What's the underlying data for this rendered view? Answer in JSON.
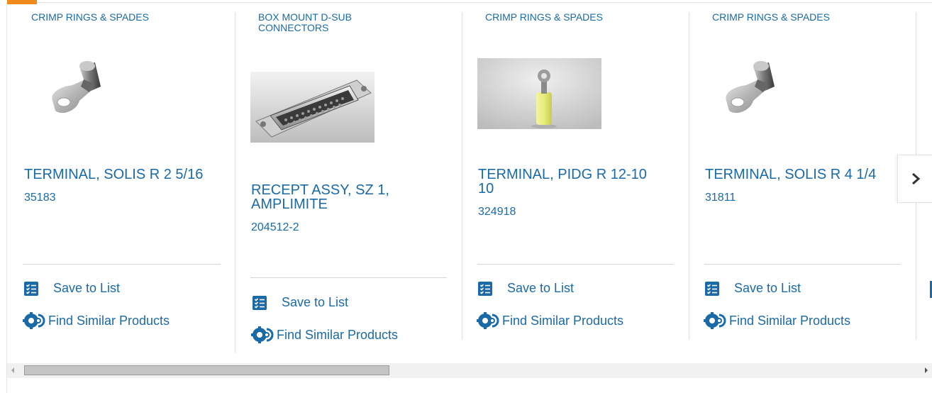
{
  "carousel": {
    "cards": [
      {
        "category": "CRIMP RINGS & SPADES",
        "title": "TERMINAL, SOLIS R 2 5/16",
        "part_number": "35183",
        "save_label": "Save to List",
        "similar_label": "Find Similar Products",
        "image": "ring-terminal-silver"
      },
      {
        "category": "BOX MOUNT D-SUB CONNECTORS",
        "title": "RECEPT ASSY, SZ 1, AMPLIMITE",
        "part_number": "204512-2",
        "save_label": "Save to List",
        "similar_label": "Find Similar Products",
        "image": "dsub-connector"
      },
      {
        "category": "CRIMP RINGS & SPADES",
        "title": "TERMINAL, PIDG R 12-10 10",
        "part_number": "324918",
        "save_label": "Save to List",
        "similar_label": "Find Similar Products",
        "image": "ring-terminal-yellow"
      },
      {
        "category": "CRIMP RINGS & SPADES",
        "title": "TERMINAL, SOLIS R 4 1/4",
        "part_number": "31811",
        "save_label": "Save to List",
        "similar_label": "Find Similar Products",
        "image": "ring-terminal-silver"
      }
    ],
    "next_icon": "chevron-right-icon"
  },
  "colors": {
    "link": "#1a6aa8",
    "accent": "#f28a1b"
  }
}
